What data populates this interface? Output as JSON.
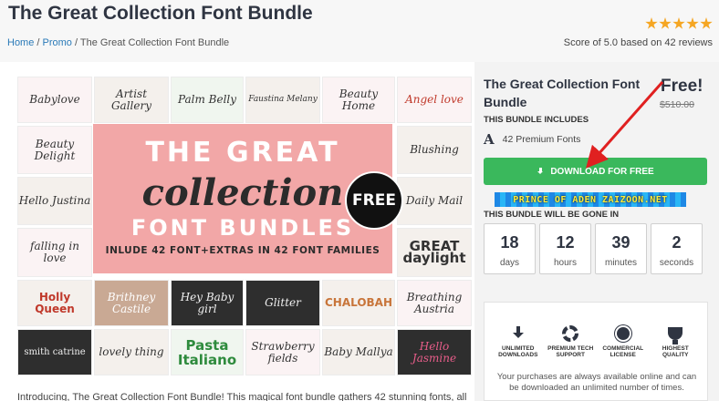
{
  "header": {
    "title": "The Great Collection Font Bundle",
    "breadcrumb": {
      "home": "Home",
      "sep1": "/",
      "promo": "Promo",
      "sep2": "/",
      "current": "The Great Collection Font Bundle"
    },
    "rating": {
      "stars": 5,
      "score_text": "Score of 5.0 based on 42 reviews"
    }
  },
  "bundle_image": {
    "hero": {
      "line1": "THE GREAT",
      "line2": "collection",
      "line3": "FONT BUNDLES",
      "line4": "INLUDE 42 FONT+EXTRAS IN 42 FONT FAMILIES"
    },
    "badge": "FREE",
    "tiles": [
      "Babylove",
      "Artist Gallery",
      "Palm Belly",
      "Faustina Melany",
      "Beauty Home",
      "Angel love",
      "Beauty Delight",
      "Blushing",
      "Hello Justina",
      "Daily Mail",
      "falling in love",
      "GREAT daylight",
      "Holly Queen",
      "Brithney Castile",
      "Hey Baby girl",
      "Glitter",
      "CHALOBAH",
      "Breathing Austria",
      "smith catrine",
      "lovely thing",
      "Pasta Italiano",
      "Strawberry fields",
      "Baby Mallya",
      "Hello Jasmine"
    ]
  },
  "intro_text": "Introducing, The Great Collection Font Bundle! This magical font bundle gathers 42 stunning fonts, all",
  "sidebar": {
    "title": "The Great Collection Font Bundle",
    "price_free": "Free!",
    "price_old": "$510.00",
    "includes_label": "THIS BUNDLE INCLUDES",
    "font_icon": "A",
    "includes_text": "42 Premium Fonts",
    "download_label": "DOWNLOAD FOR FREE",
    "watermark": "PRINCE OF ADEN ZAIZOON.NET",
    "gone_label": "THIS BUNDLE WILL BE GONE IN",
    "timer": [
      {
        "value": "18",
        "unit": "days"
      },
      {
        "value": "12",
        "unit": "hours"
      },
      {
        "value": "39",
        "unit": "minutes"
      },
      {
        "value": "2",
        "unit": "seconds"
      }
    ]
  },
  "features": {
    "items": [
      {
        "icon": "download-icon",
        "label": "UNLIMITED DOWNLOADS"
      },
      {
        "icon": "lifebuoy-icon",
        "label": "PREMIUM TECH SUPPORT"
      },
      {
        "icon": "medal-icon",
        "label": "COMMERCIAL LICENSE"
      },
      {
        "icon": "trophy-icon",
        "label": "HIGHEST QUALITY"
      }
    ],
    "text": "Your purchases are always available online and can be downloaded an unlimited number of times."
  },
  "colors": {
    "accent_green": "#3ab85c",
    "hero_pink": "#f2a7a7",
    "star": "#f5a623",
    "arrow_red": "#e02020"
  }
}
